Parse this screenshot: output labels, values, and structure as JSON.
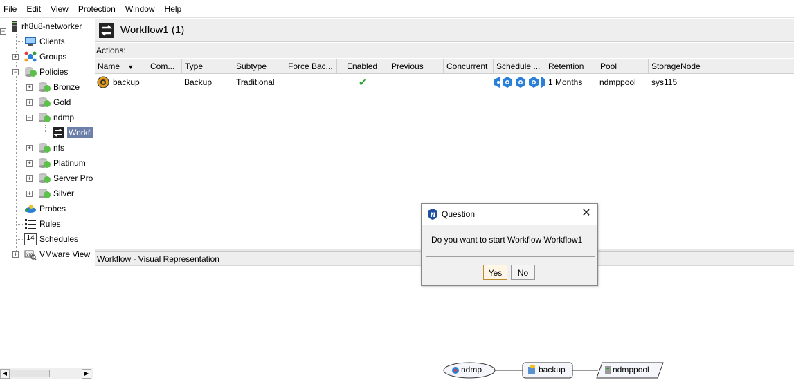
{
  "menu": [
    "File",
    "Edit",
    "View",
    "Protection",
    "Window",
    "Help"
  ],
  "tree": {
    "root": "rh8u8-networker",
    "items": {
      "clients": "Clients",
      "groups": "Groups",
      "policies": "Policies",
      "bronze": "Bronze",
      "gold": "Gold",
      "ndmp": "ndmp",
      "workflow": "Workfl",
      "nfs": "nfs",
      "platinum": "Platinum",
      "server_protection": "Server Pro",
      "silver": "Silver",
      "probes": "Probes",
      "rules": "Rules",
      "schedules": "Schedules",
      "vmware_view": "VMware View"
    },
    "schedules_icon_number": "14"
  },
  "header": {
    "title": "Workflow1 (1)"
  },
  "actions": {
    "label": "Actions:"
  },
  "table": {
    "columns": [
      "Name",
      "Com...",
      "Type",
      "Subtype",
      "Force Bac...",
      "Enabled",
      "Previous",
      "Concurrent",
      "Schedule ...",
      "Retention",
      "Pool",
      "StorageNode"
    ],
    "row": {
      "name": "backup",
      "type": "Backup",
      "subtype": "Traditional",
      "enabled": "✔",
      "retention": "1 Months",
      "pool": "ndmppool",
      "storage_node": "sys115"
    }
  },
  "visual": {
    "header": "Workflow - Visual Representation",
    "nodes": {
      "policy": "ndmp",
      "action": "backup",
      "pool": "ndmppool"
    }
  },
  "dialog": {
    "title": "Question",
    "message": "Do you want to start Workflow Workflow1",
    "yes_label": "Yes",
    "no_label": "No",
    "close_glyph": "✕"
  },
  "colors": {
    "selection": "#6b7fa8",
    "enabled_check": "#2aa02a",
    "schedule_icon": "#2a7fd6",
    "yes_border": "#c08a2e"
  }
}
